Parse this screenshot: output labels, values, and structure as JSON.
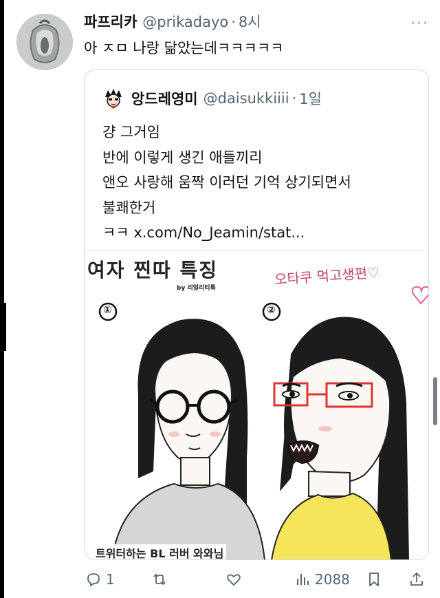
{
  "tweet": {
    "display_name": "파프리카",
    "handle": "@prikadayo",
    "separator": "·",
    "time": "8시",
    "more": "···",
    "text": "아 ㅈㅁ 나랑 닮았는데ㅋㅋㅋㅋㅋ"
  },
  "quote": {
    "display_name": "앙드레영미",
    "handle": "@daisukkiiii",
    "separator": "·",
    "time": "1일",
    "lines": [
      "걍 그거임",
      "반에 이렇게 생긴 애들끼리",
      "앤오 사랑해 움짝 이러던 기억 상기되면서",
      "불쾌한거",
      "ㅋㅋ x.com/No_Jeamin/stat..."
    ],
    "image": {
      "title": "여자 찐따 특징",
      "byline": "by 리얼리티톡",
      "label_1": "①",
      "label_2": "②",
      "handwriting": "오타쿠 먹고생편♡",
      "bottom_caption": "트위터하는 BL 러버 와와님"
    }
  },
  "actions": {
    "replies": "1",
    "views": "2088"
  },
  "colors": {
    "text": "#0f1419",
    "secondary": "#536471",
    "border": "#cfd9de"
  }
}
